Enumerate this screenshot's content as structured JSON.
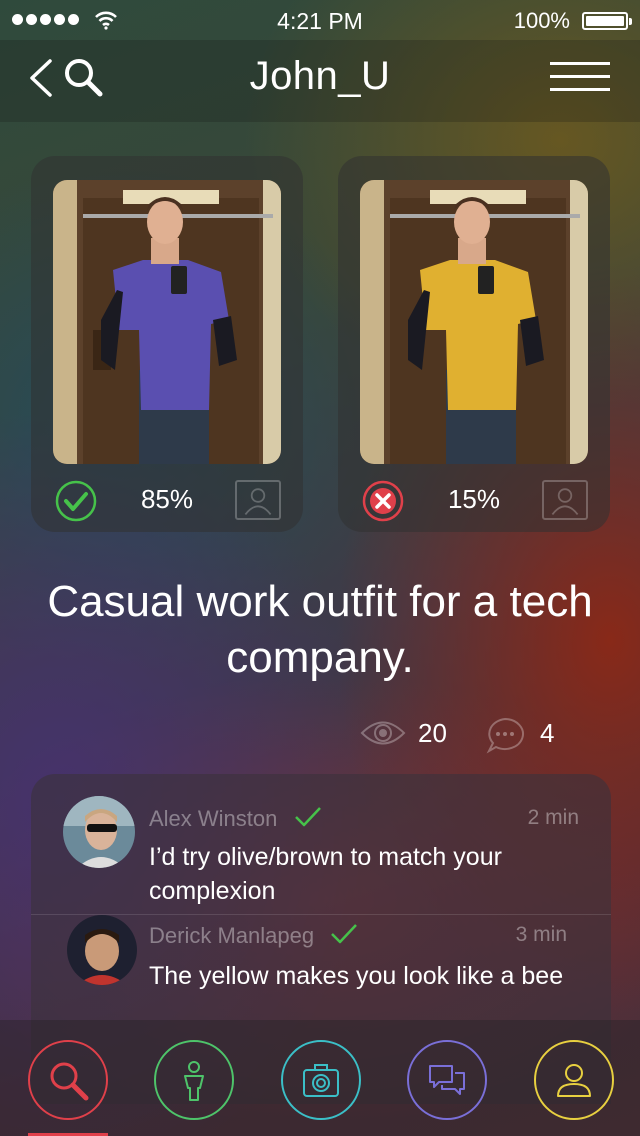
{
  "status_bar": {
    "time": "4:21 PM",
    "battery": "100%"
  },
  "nav": {
    "title": "John_U"
  },
  "outfits": [
    {
      "percent": "85%",
      "vote": "approve",
      "shirt_color": "#5a4fb0"
    },
    {
      "percent": "15%",
      "vote": "reject",
      "shirt_color": "#e0b030"
    }
  ],
  "caption": "Casual work outfit for a tech company.",
  "stats": {
    "views": "20",
    "comments": "4"
  },
  "comments": [
    {
      "author": "Alex Winston",
      "time": "2 min",
      "text": "I’d try olive/brown to match your complexion"
    },
    {
      "author": "Derick Manlapeg",
      "time": "3 min",
      "text": "The yellow makes you look like a bee"
    }
  ],
  "colors": {
    "approve": "#46c24a",
    "reject": "#e0404a",
    "tab_search": "#e0404a",
    "tab_outfit": "#4ec46a",
    "tab_camera": "#3bbfc7",
    "tab_messages": "#7a6fd8",
    "tab_profile": "#e8d040"
  },
  "tabs": [
    {
      "name": "search",
      "icon": "search-icon"
    },
    {
      "name": "outfit",
      "icon": "person-icon"
    },
    {
      "name": "camera",
      "icon": "camera-icon"
    },
    {
      "name": "messages",
      "icon": "chat-icon"
    },
    {
      "name": "profile",
      "icon": "user-icon"
    }
  ]
}
